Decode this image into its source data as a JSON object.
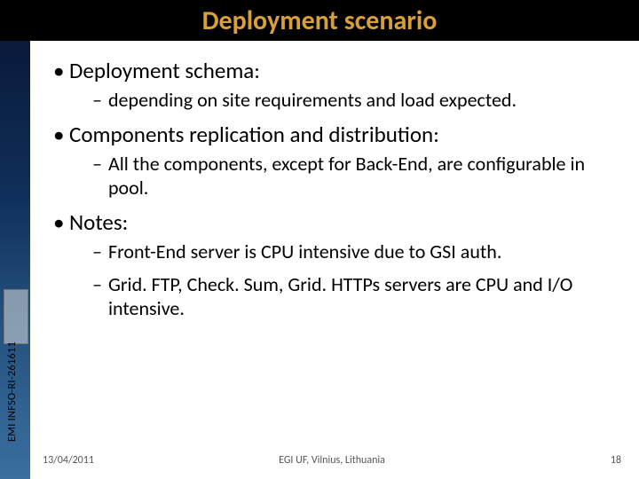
{
  "title": "Deployment scenario",
  "bullets": {
    "b1": "Deployment schema:",
    "b1_1": "depending on site requirements and load expected.",
    "b2": "Components replication and distribution:",
    "b2_1": "All the components, except for Back-End, are configurable in pool.",
    "b3": "Notes:",
    "b3_1": "Front-End server is CPU intensive due to GSI auth.",
    "b3_2": "Grid. FTP, Check. Sum, Grid. HTTPs servers are CPU and I/O intensive."
  },
  "sidebar_text": "EMI INFSO-RI-261611",
  "footer": {
    "date": "13/04/2011",
    "venue": "EGI UF, Vilnius, Lithuania",
    "page": "18"
  }
}
